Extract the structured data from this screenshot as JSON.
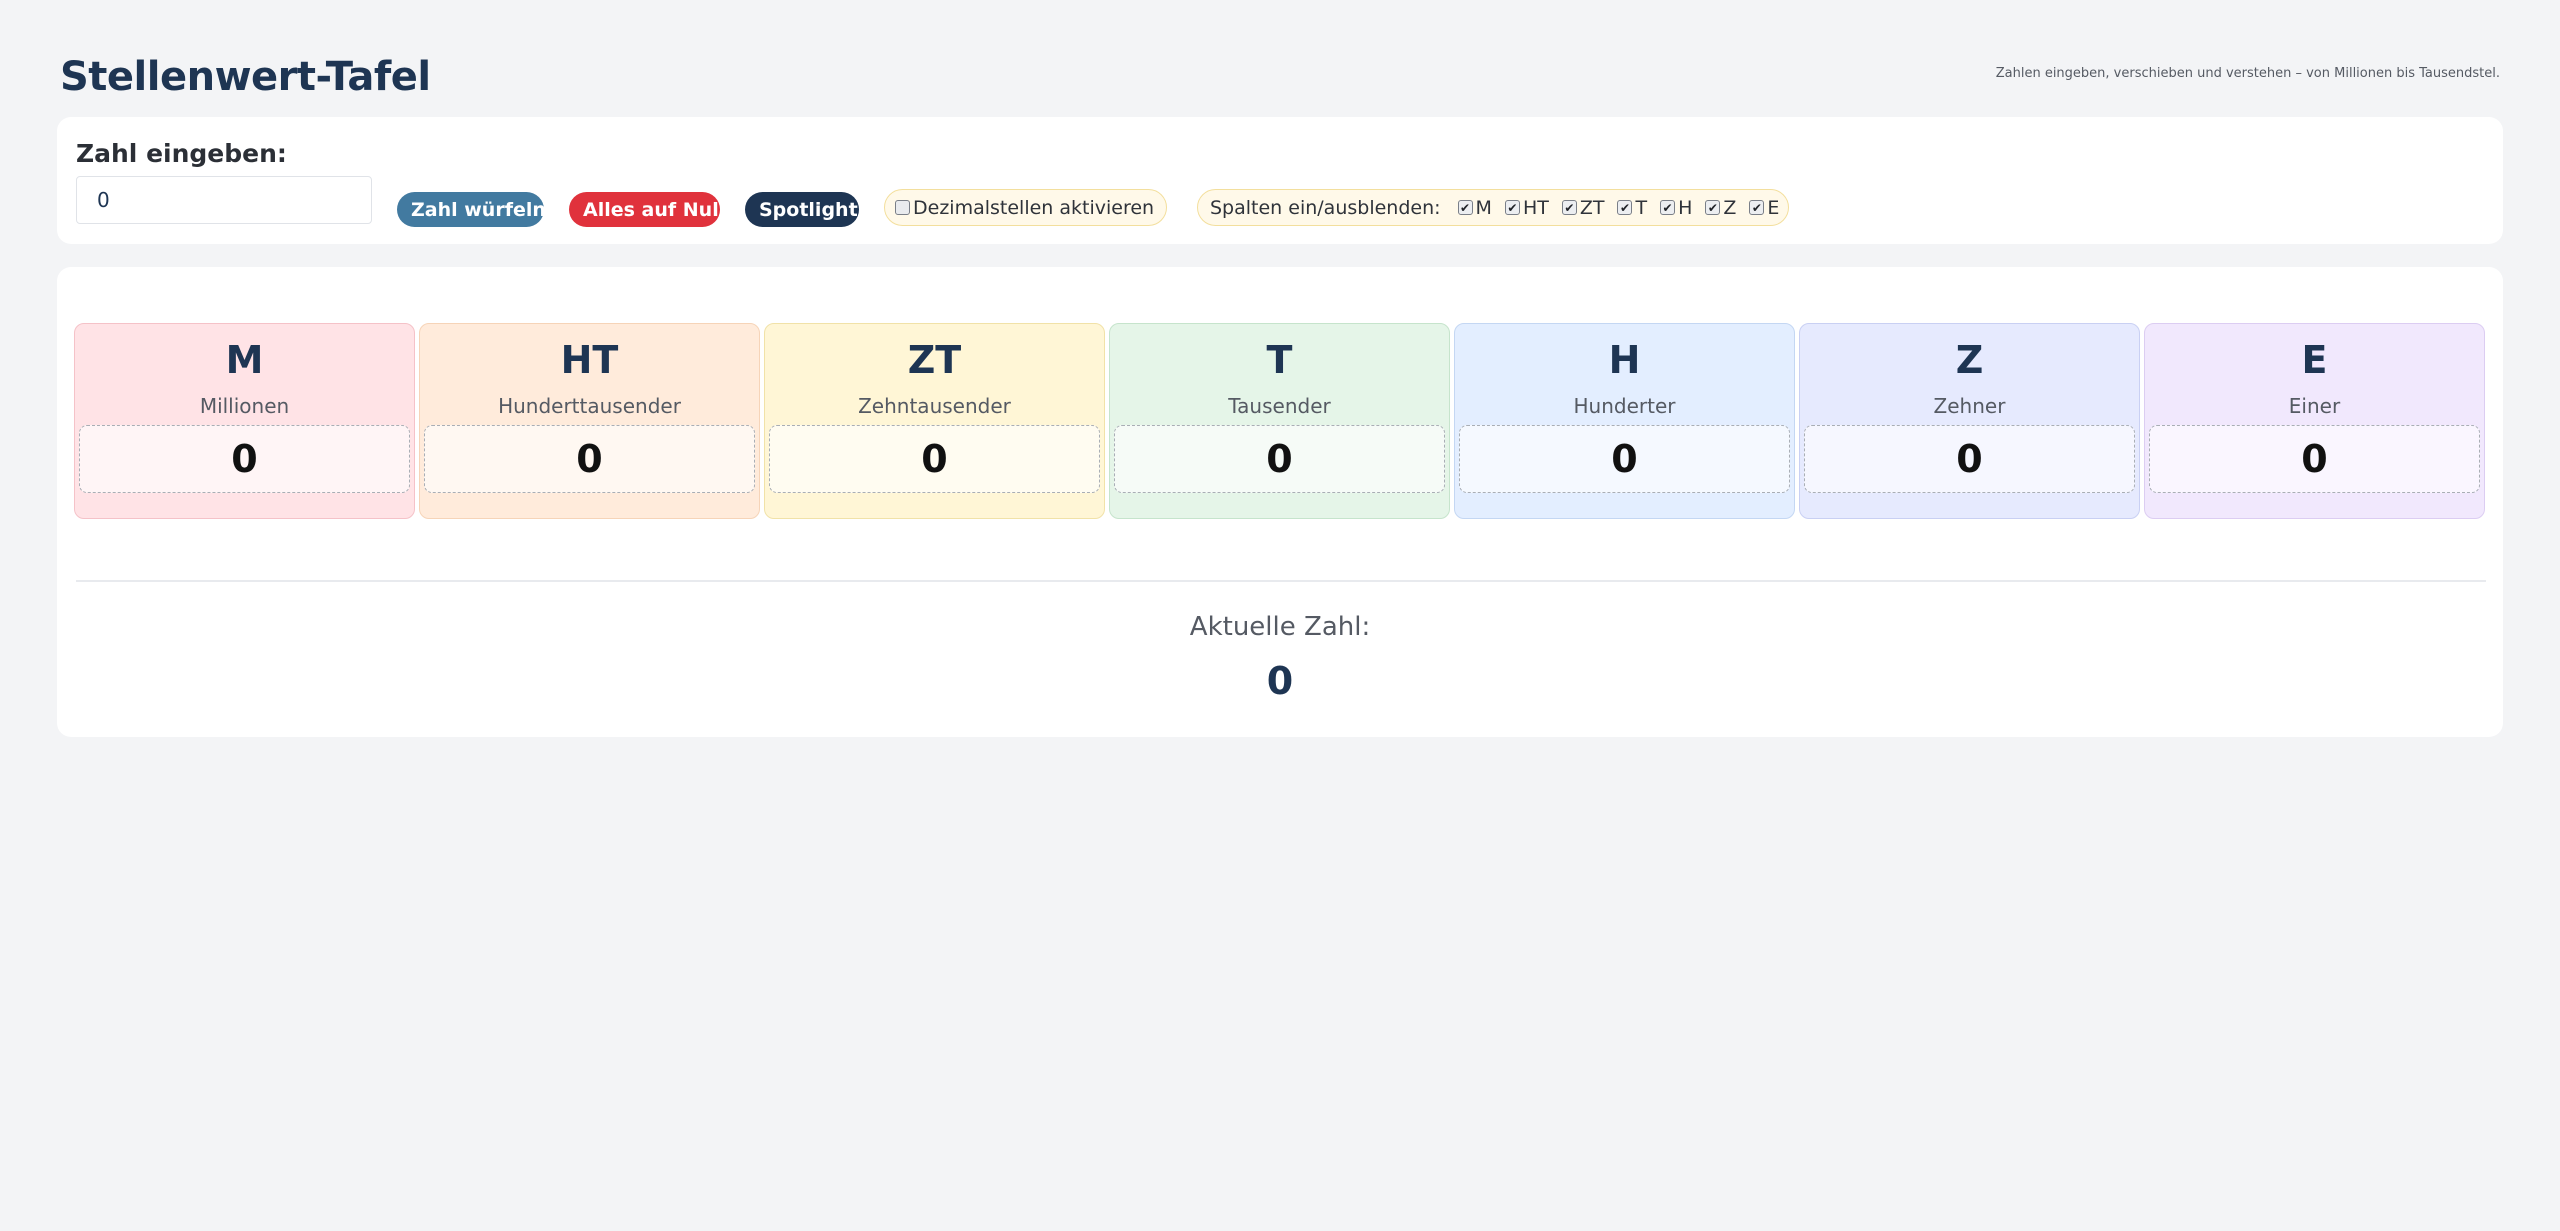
{
  "header": {
    "title": "Stellenwert-Tafel",
    "subtitle": "Zahlen eingeben, verschieben und verstehen – von Millionen bis Tausendstel."
  },
  "controls": {
    "input_label": "Zahl eingeben:",
    "input_value": "0",
    "random_button": "Zahl würfeln",
    "zero_button": "Alles auf Null",
    "spotlight_button": "Spotlight",
    "decimal_label": "Dezimalstellen aktivieren",
    "decimal_checked": false,
    "columns_label": "Spalten ein/ausblenden:",
    "column_toggles": [
      {
        "label": "M",
        "checked": true
      },
      {
        "label": "HT",
        "checked": true
      },
      {
        "label": "ZT",
        "checked": true
      },
      {
        "label": "T",
        "checked": true
      },
      {
        "label": "H",
        "checked": true
      },
      {
        "label": "Z",
        "checked": true
      },
      {
        "label": "E",
        "checked": true
      }
    ]
  },
  "places": [
    {
      "abbr": "M",
      "name": "Millionen",
      "digit": "0",
      "bg": "#ffe3e6",
      "border": "#f5c2c8",
      "digit_bg": "#fff5f6"
    },
    {
      "abbr": "HT",
      "name": "Hunderttausender",
      "digit": "0",
      "bg": "#ffebdb",
      "border": "#f6d4b8",
      "digit_bg": "#fff8f2"
    },
    {
      "abbr": "ZT",
      "name": "Zehntausender",
      "digit": "0",
      "bg": "#fff6d6",
      "border": "#f1e2a8",
      "digit_bg": "#fffcf1"
    },
    {
      "abbr": "T",
      "name": "Tausender",
      "digit": "0",
      "bg": "#e5f5e8",
      "border": "#c6e4cc",
      "digit_bg": "#f6fbf7"
    },
    {
      "abbr": "H",
      "name": "Hunderter",
      "digit": "0",
      "bg": "#e3eeff",
      "border": "#c4d7f3",
      "digit_bg": "#f5f9ff"
    },
    {
      "abbr": "Z",
      "name": "Zehner",
      "digit": "0",
      "bg": "#e6eafe",
      "border": "#c9d0f3",
      "digit_bg": "#f6f7ff"
    },
    {
      "abbr": "E",
      "name": "Einer",
      "digit": "0",
      "bg": "#f1e8fd",
      "border": "#dccdf2",
      "digit_bg": "#faf6ff"
    }
  ],
  "result": {
    "label": "Aktuelle Zahl:",
    "value": "0"
  }
}
